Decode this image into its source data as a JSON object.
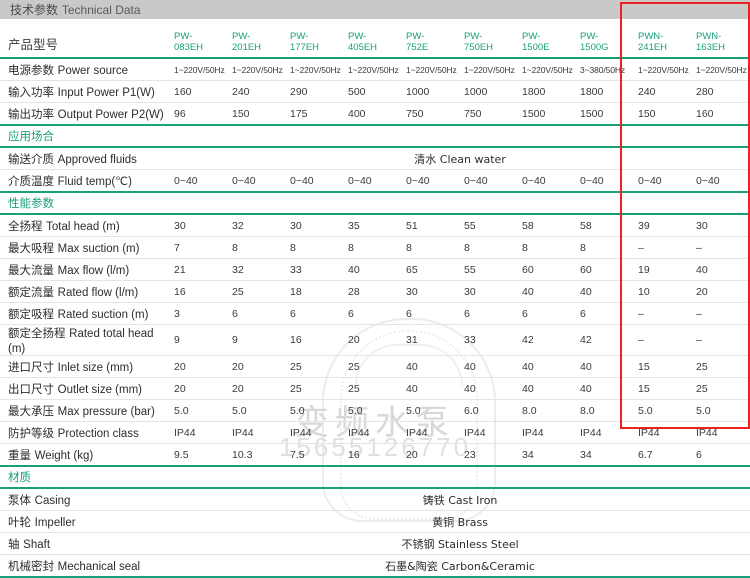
{
  "banner": {
    "title_cn": "技术参数",
    "title_en": "Technical Data"
  },
  "columns": [
    {
      "line1": "PW-",
      "line2": "083EH"
    },
    {
      "line1": "PW-",
      "line2": "201EH"
    },
    {
      "line1": "PW-",
      "line2": "177EH"
    },
    {
      "line1": "PW-",
      "line2": "405EH"
    },
    {
      "line1": "PW-",
      "line2": "752E"
    },
    {
      "line1": "PW-",
      "line2": "750EH"
    },
    {
      "line1": "PW-",
      "line2": "1500E"
    },
    {
      "line1": "PW-",
      "line2": "1500G"
    },
    {
      "line1": "PWN-",
      "line2": "241EH"
    },
    {
      "line1": "PWN-",
      "line2": "163EH"
    }
  ],
  "row_labels": {
    "model": {
      "cn": "产品型号",
      "en": ""
    },
    "power_source": {
      "cn": "电源参数",
      "en": "Power source"
    },
    "input_power": {
      "cn": "输入功率",
      "en": "Input Power P1(W)"
    },
    "output_power": {
      "cn": "输出功率",
      "en": "Output Power P2(W)"
    },
    "approved_fluids": {
      "cn": "输送介质",
      "en": "Approved fluids"
    },
    "fluid_temp": {
      "cn": "介质温度",
      "en": "Fluid temp(℃)"
    },
    "total_head": {
      "cn": "全扬程",
      "en": "Total head (m)"
    },
    "max_suction": {
      "cn": "最大吸程",
      "en": "Max suction (m)"
    },
    "max_flow": {
      "cn": "最大流量",
      "en": "Max flow (l/m)"
    },
    "rated_flow": {
      "cn": "额定流量",
      "en": "Rated flow (l/m)"
    },
    "rated_suction": {
      "cn": "额定吸程",
      "en": "Rated suction (m)"
    },
    "rated_total_head": {
      "cn": "额定全扬程",
      "en": "Rated total head (m)"
    },
    "inlet_size": {
      "cn": "进口尺寸",
      "en": "Inlet size (mm)"
    },
    "outlet_size": {
      "cn": "出口尺寸",
      "en": "Outlet size (mm)"
    },
    "max_pressure": {
      "cn": "最大承压",
      "en": "Max pressure (bar)"
    },
    "protection_class": {
      "cn": "防护等级",
      "en": "Protection class"
    },
    "weight": {
      "cn": "重量",
      "en": "Weight (kg)"
    },
    "casing": {
      "cn": "泵体",
      "en": "Casing"
    },
    "impeller": {
      "cn": "叶轮",
      "en": "Impeller"
    },
    "shaft": {
      "cn": "轴",
      "en": "Shaft"
    },
    "mechanical_seal": {
      "cn": "机械密封",
      "en": "Mechanical seal"
    }
  },
  "sections": {
    "application": "应用场合",
    "performance": "性能参数",
    "material": "材质"
  },
  "rows": {
    "power_source": [
      "1~220V/50Hz",
      "1~220V/50Hz",
      "1~220V/50Hz",
      "1~220V/50Hz",
      "1~220V/50Hz",
      "1~220V/50Hz",
      "1~220V/50Hz",
      "3~380/50Hz",
      "1~220V/50Hz",
      "1~220V/50Hz"
    ],
    "input_power": [
      "160",
      "240",
      "290",
      "500",
      "1000",
      "1000",
      "1800",
      "1800",
      "240",
      "280"
    ],
    "output_power": [
      "96",
      "150",
      "175",
      "400",
      "750",
      "750",
      "1500",
      "1500",
      "150",
      "160"
    ],
    "fluid_temp": [
      "0~40",
      "0~40",
      "0~40",
      "0~40",
      "0~40",
      "0~40",
      "0~40",
      "0~40",
      "0~40",
      "0~40"
    ],
    "total_head": [
      "30",
      "32",
      "30",
      "35",
      "51",
      "55",
      "58",
      "58",
      "39",
      "30"
    ],
    "max_suction": [
      "7",
      "8",
      "8",
      "8",
      "8",
      "8",
      "8",
      "8",
      "–",
      "–"
    ],
    "max_flow": [
      "21",
      "32",
      "33",
      "40",
      "65",
      "55",
      "60",
      "60",
      "19",
      "40"
    ],
    "rated_flow": [
      "16",
      "25",
      "18",
      "28",
      "30",
      "30",
      "40",
      "40",
      "10",
      "20"
    ],
    "rated_suction": [
      "3",
      "6",
      "6",
      "6",
      "6",
      "6",
      "6",
      "6",
      "–",
      "–"
    ],
    "rated_total_head": [
      "9",
      "9",
      "16",
      "20",
      "31",
      "33",
      "42",
      "42",
      "–",
      "–"
    ],
    "inlet_size": [
      "20",
      "20",
      "25",
      "25",
      "40",
      "40",
      "40",
      "40",
      "15",
      "25"
    ],
    "outlet_size": [
      "20",
      "20",
      "25",
      "25",
      "40",
      "40",
      "40",
      "40",
      "15",
      "25"
    ],
    "max_pressure": [
      "5.0",
      "5.0",
      "5.0",
      "5.0",
      "5.0",
      "6.0",
      "8.0",
      "8.0",
      "5.0",
      "5.0"
    ],
    "protection_class": [
      "IP44",
      "IP44",
      "IP44",
      "IP44",
      "IP44",
      "IP44",
      "IP44",
      "IP44",
      "IP44",
      "IP44"
    ],
    "weight": [
      "9.5",
      "10.3",
      "7.5",
      "16",
      "20",
      "23",
      "34",
      "34",
      "6.7",
      "6"
    ]
  },
  "merged_values": {
    "approved_fluids": "清水 Clean water",
    "casing": "铸铁 Cast Iron",
    "impeller": "黄铜 Brass",
    "shaft": "不锈钢 Stainless Steel",
    "mechanical_seal": "石墨&陶瓷 Carbon&Ceramic"
  },
  "watermark": {
    "text": "变频水泵",
    "phone": "15655126770"
  },
  "highlight": {
    "label": "highlighted-models",
    "color": "#ee2020",
    "models": [
      "PWN-241EH",
      "PWN-163EH"
    ]
  },
  "colors": {
    "accent": "#18a07a",
    "banner": "#c9c9c9",
    "highlight": "#ee2020"
  }
}
